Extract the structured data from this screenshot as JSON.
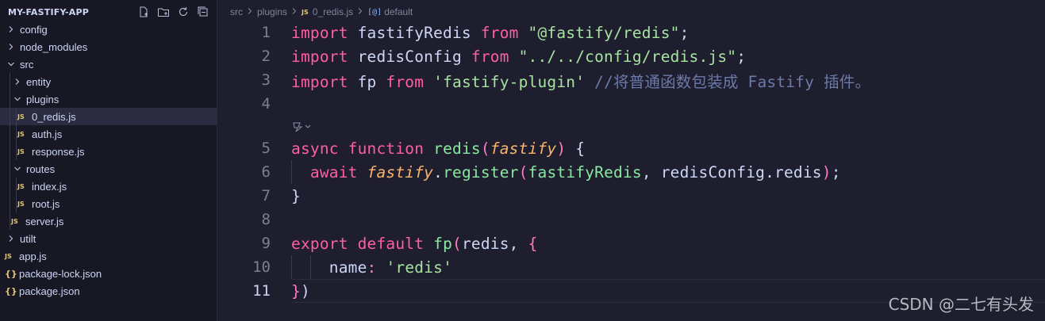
{
  "explorer": {
    "title": "MY-FASTIFY-APP",
    "actions": [
      {
        "name": "new-file-icon",
        "label": "New File"
      },
      {
        "name": "new-folder-icon",
        "label": "New Folder"
      },
      {
        "name": "refresh-icon",
        "label": "Refresh"
      },
      {
        "name": "collapse-all-icon",
        "label": "Collapse"
      }
    ],
    "items": [
      {
        "label": "config",
        "type": "folder",
        "expanded": false,
        "depth": 0
      },
      {
        "label": "node_modules",
        "type": "folder",
        "expanded": false,
        "depth": 0
      },
      {
        "label": "src",
        "type": "folder",
        "expanded": true,
        "depth": 0
      },
      {
        "label": "entity",
        "type": "folder",
        "expanded": false,
        "depth": 1
      },
      {
        "label": "plugins",
        "type": "folder",
        "expanded": true,
        "depth": 1
      },
      {
        "label": "0_redis.js",
        "type": "js",
        "depth": 2,
        "active": true
      },
      {
        "label": "auth.js",
        "type": "js",
        "depth": 2
      },
      {
        "label": "response.js",
        "type": "js",
        "depth": 2
      },
      {
        "label": "routes",
        "type": "folder",
        "expanded": true,
        "depth": 1
      },
      {
        "label": "index.js",
        "type": "js",
        "depth": 2
      },
      {
        "label": "root.js",
        "type": "js",
        "depth": 2
      },
      {
        "label": "server.js",
        "type": "js",
        "depth": 1
      },
      {
        "label": "utilt",
        "type": "folder",
        "expanded": false,
        "depth": 0
      },
      {
        "label": "app.js",
        "type": "js",
        "depth": 0
      },
      {
        "label": "package-lock.json",
        "type": "json",
        "depth": 0
      },
      {
        "label": "package.json",
        "type": "json",
        "depth": 0
      }
    ],
    "js_badge": "JS",
    "json_badge": "{}"
  },
  "breadcrumb": {
    "parts": [
      "src",
      "plugins"
    ],
    "file": "0_redis.js",
    "js_badge": "JS",
    "symbol_icon": "[@]",
    "symbol": "default"
  },
  "code": {
    "current_line": 11,
    "lines": [
      {
        "n": "1",
        "tokens": [
          [
            "fc",
            "import"
          ],
          [
            "pp",
            " fastifyRedis "
          ],
          [
            "fc",
            "from"
          ],
          [
            "pp",
            " "
          ],
          [
            "str",
            "\"@fastify/redis\""
          ],
          [
            "pp",
            ";"
          ]
        ]
      },
      {
        "n": "2",
        "tokens": [
          [
            "fc",
            "import"
          ],
          [
            "pp",
            " redisConfig "
          ],
          [
            "fc",
            "from"
          ],
          [
            "pp",
            " "
          ],
          [
            "str",
            "\"../../config/redis.js\""
          ],
          [
            "pp",
            ";"
          ]
        ]
      },
      {
        "n": "3",
        "tokens": [
          [
            "fc",
            "import"
          ],
          [
            "pp",
            " fp "
          ],
          [
            "fc",
            "from"
          ],
          [
            "pp",
            " "
          ],
          [
            "str",
            "'fastify-plugin'"
          ],
          [
            "pp",
            " "
          ],
          [
            "cm",
            "//将普通函数包装成 Fastify 插件。"
          ]
        ]
      },
      {
        "n": "4",
        "tokens": []
      },
      {
        "n": "",
        "lens": true,
        "tokens": []
      },
      {
        "n": "5",
        "tokens": [
          [
            "fc",
            "async"
          ],
          [
            "pp",
            " "
          ],
          [
            "fc",
            "function"
          ],
          [
            "pp",
            " "
          ],
          [
            "fn",
            "redis"
          ],
          [
            "pn",
            "("
          ],
          [
            "prm",
            "fastify"
          ],
          [
            "pn",
            ")"
          ],
          [
            "pp",
            " {"
          ]
        ]
      },
      {
        "n": "6",
        "indent": 1,
        "tokens": [
          [
            "pp",
            "  "
          ],
          [
            "fc",
            "await"
          ],
          [
            "pp",
            " "
          ],
          [
            "prm",
            "fastify"
          ],
          [
            "pp",
            "."
          ],
          [
            "fn",
            "register"
          ],
          [
            "pn",
            "("
          ],
          [
            "fn",
            "fastifyRedis"
          ],
          [
            "pp",
            ", redisConfig.redis"
          ],
          [
            "pn",
            ")"
          ],
          [
            "pp",
            ";"
          ]
        ]
      },
      {
        "n": "7",
        "tokens": [
          [
            "pp",
            "}"
          ]
        ]
      },
      {
        "n": "8",
        "tokens": []
      },
      {
        "n": "9",
        "tokens": [
          [
            "fc",
            "export"
          ],
          [
            "pp",
            " "
          ],
          [
            "fc",
            "default"
          ],
          [
            "pp",
            " "
          ],
          [
            "fn",
            "fp"
          ],
          [
            "pn",
            "("
          ],
          [
            "pp",
            "redis, "
          ],
          [
            "pn",
            "{"
          ]
        ]
      },
      {
        "n": "10",
        "indent": 2,
        "tokens": [
          [
            "pp",
            "    name"
          ],
          [
            "pn",
            ":"
          ],
          [
            "pp",
            " "
          ],
          [
            "str",
            "'redis'"
          ]
        ]
      },
      {
        "n": "11",
        "tokens": [
          [
            "pn",
            "}"
          ],
          [
            "pp",
            ")"
          ]
        ]
      }
    ]
  },
  "watermark": "CSDN @二七有头发",
  "colors": {
    "background": "#1e1e2e",
    "sidebar": "#181825",
    "keyword": "#ff5fa2",
    "string": "#a6e3a1",
    "function": "#89e7a0",
    "parameter": "#f9b36b",
    "comment": "#6c7aa8",
    "js_badge": "#e5c76b"
  }
}
